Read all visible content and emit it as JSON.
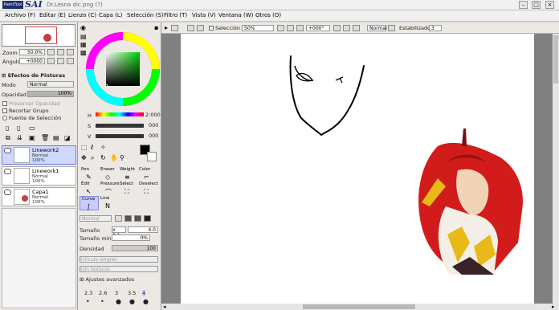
{
  "title": {
    "logo_text": "PaintTool",
    "app_name": "SAI",
    "document": "Dr.Lesna dic.png (?)"
  },
  "window_buttons": [
    "–",
    "□",
    "×"
  ],
  "menu": [
    "Archivo (F)",
    "Editar (E)",
    "Lienzo (C)",
    "Capa (L)",
    "Selección (S)",
    "Filtro (T)",
    "Vista (V)",
    "Ventana (W)",
    "Otros (O)"
  ],
  "navigator": {
    "zoom_label": "Zoom",
    "zoom_value": "50.0%",
    "angle_label": "Ángulo",
    "angle_value": "+0000"
  },
  "effects": {
    "title": "Efectos de Pinturas",
    "mode_label": "Modo",
    "mode_value": "Normal",
    "opacity_label": "Opacidad",
    "opacity_value": "100%",
    "opacity_level": 1.0
  },
  "layer_options": {
    "preserve": "Preservar Opacidad",
    "clip": "Recortar Grupo",
    "source": "Fuente de Selección"
  },
  "layers": [
    {
      "name": "Linework2",
      "mode": "Normal",
      "opacity": "100%",
      "selected": true
    },
    {
      "name": "Linework1",
      "mode": "Normal",
      "opacity": "100%",
      "selected": false
    },
    {
      "name": "Capa1",
      "mode": "Normal",
      "opacity": "100%",
      "selected": false
    }
  ],
  "color": {
    "h_label": "H",
    "h_value": "2:000",
    "s_label": "S",
    "s_value": "000",
    "v_label": "V",
    "v_value": "000",
    "current": "#000000"
  },
  "tools": [
    {
      "name": "Pen",
      "icon": "✎"
    },
    {
      "name": "Eraser",
      "icon": "◇"
    },
    {
      "name": "Weight",
      "icon": "≡"
    },
    {
      "name": "Color",
      "icon": "⌐"
    },
    {
      "name": "Edit",
      "icon": "↖"
    },
    {
      "name": "Pressure",
      "icon": "⌒"
    },
    {
      "name": "Select",
      "icon": "⛶"
    },
    {
      "name": "Deselect",
      "icon": "⛶"
    },
    {
      "name": "Curve",
      "icon": "∫"
    },
    {
      "name": "Line",
      "icon": "N"
    }
  ],
  "brush": {
    "blend_mode": "Normal",
    "size_label": "Tamaño",
    "size_mult": "x 0.1",
    "size_value": "4.0",
    "min_size_label": "Tamaño min.",
    "min_size_value": "0%",
    "density_label": "Densidad",
    "density_value": "100",
    "shape_label": "(círculo simple)",
    "texture_label": "(sin textura)",
    "advanced_label": "Ajustes avanzados",
    "presets": [
      "2.3",
      "2.6",
      "3",
      "3.5",
      "4"
    ]
  },
  "toolbar": {
    "selection_label": "Selección",
    "zoom_value": "50%",
    "angle_value": "+000°",
    "mode_value": "Normal",
    "stabilizer_label": "Estabilizador",
    "stabilizer_value": "3"
  },
  "colors": {
    "panel_bg": "#ece9e4",
    "canvas_bg": "#808080",
    "selected_layer": "#cfd8ff",
    "accent": "#1c2e6a"
  }
}
